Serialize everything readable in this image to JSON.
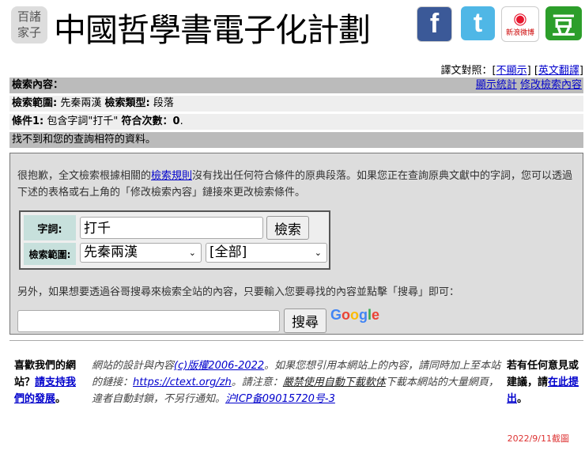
{
  "header": {
    "logo_text": "百諸家子",
    "logo_lines": [
      "百諸",
      "家子"
    ],
    "title": "中國哲學書電子化計劃",
    "social": [
      "facebook-icon",
      "twitter-icon",
      "weibo-icon",
      "douban-icon"
    ],
    "weibo_label": "新浪微博",
    "douban_glyph": "豆",
    "fb_glyph": "f",
    "tw_glyph": "t"
  },
  "translation": {
    "label": "譯文對照：",
    "off": "不顯示",
    "en": "英文翻譯"
  },
  "bars": {
    "query_label": "檢索內容：",
    "stats_link": "顯示統計",
    "modify_link": "修改檢索內容",
    "scope_label": "檢索範圍:",
    "scope_value": "先秦兩漢",
    "type_label": "檢索類型:",
    "type_value": "段落",
    "cond_label": "條件1:",
    "cond_text": "包含字詞\"打千\"",
    "count_label": "符合次數：",
    "count_value": "0",
    "no_result": "找不到和您的查詢相符的資料。"
  },
  "box": {
    "p1_a": "很抱歉，全文檢索根據相關的",
    "rules_link": "檢索規則",
    "p1_b": "沒有找出任何符合條件的原典段落。如果您正在查詢原典文獻中的字詞，您可以透過下述的表格或右上角的「修改檢索內容」鏈接來更改檢索條件。",
    "word_label": "字詞:",
    "word_value": "打千",
    "search_button": "檢索",
    "scope_label": "檢索範圍:",
    "scope_select": "先秦兩漢",
    "sub_select": "[全部]",
    "p2": "另外，如果想要透過谷哥搜尋來檢索全站的內容，只要輸入您要尋找的內容並點擊「搜尋」即可：",
    "google_input": "",
    "google_button": "搜尋",
    "google_logo": "Google"
  },
  "footer": {
    "c1_a": "喜歡我們的網站？",
    "c1_link": "請支持我們的發展",
    "c1_b": "。",
    "c2_a": "網站的設計與內容",
    "c2_copyright": "(c)版權2006-2022",
    "c2_b": "。如果您想引用本網站上的內容，請同時加上至本站的鏈接：",
    "c2_url": "https://ctext.org/zh",
    "c2_c": "。請注意：",
    "c2_warn": "嚴禁使用自動下載軟体",
    "c2_d": "下載本網站的大量網頁，違者自動封鎖，不另行通知。",
    "c2_icp": "沪ICP备09015720号-3",
    "c3_a": "若有任何意見或建議，請",
    "c3_link": "在此提出",
    "c3_b": "。"
  },
  "stamp": "2022/9/11截圖",
  "colors": {
    "link": "#0000cc",
    "bar_dark": "#bbbbbb",
    "bar_light": "#eeeeee",
    "stamp": "#dd3333"
  }
}
